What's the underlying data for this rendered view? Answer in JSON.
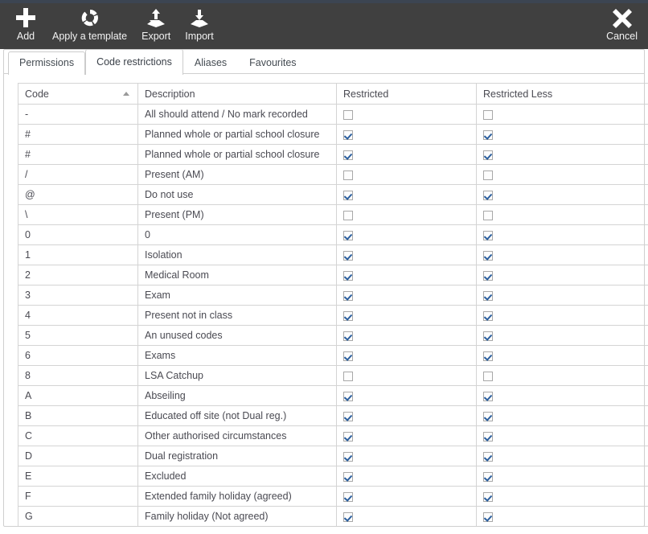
{
  "toolbar": {
    "buttons": [
      {
        "label": "Add",
        "icon": "plus-icon"
      },
      {
        "label": "Apply a template",
        "icon": "template-refresh-icon"
      },
      {
        "label": "Export",
        "icon": "export-up-arrow-icon"
      },
      {
        "label": "Import",
        "icon": "import-down-arrow-icon"
      }
    ],
    "cancel": {
      "label": "Cancel",
      "icon": "close-x-icon"
    },
    "background_color": "#404040",
    "accent_strip_color": "#3c4552"
  },
  "tabs": [
    {
      "label": "Permissions",
      "active": false
    },
    {
      "label": "Code restrictions",
      "active": true
    },
    {
      "label": "Aliases",
      "active": false
    },
    {
      "label": "Favourites",
      "active": false
    }
  ],
  "grid": {
    "columns": [
      {
        "key": "code",
        "label": "Code",
        "sort": "asc"
      },
      {
        "key": "description",
        "label": "Description",
        "sort": ""
      },
      {
        "key": "restricted",
        "label": "Restricted",
        "sort": ""
      },
      {
        "key": "restricted_less",
        "label": "Restricted Less",
        "sort": ""
      }
    ],
    "rows": [
      {
        "code": "-",
        "description": "All should attend / No mark recorded",
        "restricted": false,
        "restricted_less": false
      },
      {
        "code": "#",
        "description": "Planned whole or partial school closure",
        "restricted": true,
        "restricted_less": true
      },
      {
        "code": "#",
        "description": "Planned whole or partial school closure",
        "restricted": true,
        "restricted_less": true
      },
      {
        "code": "/",
        "description": "Present (AM)",
        "restricted": false,
        "restricted_less": false
      },
      {
        "code": "@",
        "description": "Do not use",
        "restricted": true,
        "restricted_less": true
      },
      {
        "code": "\\",
        "description": "Present (PM)",
        "restricted": false,
        "restricted_less": false
      },
      {
        "code": "0",
        "description": "0",
        "restricted": true,
        "restricted_less": true
      },
      {
        "code": "1",
        "description": "Isolation",
        "restricted": true,
        "restricted_less": true
      },
      {
        "code": "2",
        "description": "Medical Room",
        "restricted": true,
        "restricted_less": true
      },
      {
        "code": "3",
        "description": "Exam",
        "restricted": true,
        "restricted_less": true
      },
      {
        "code": "4",
        "description": "Present not in class",
        "restricted": true,
        "restricted_less": true
      },
      {
        "code": "5",
        "description": "An unused codes",
        "restricted": true,
        "restricted_less": true
      },
      {
        "code": "6",
        "description": "Exams",
        "restricted": true,
        "restricted_less": true
      },
      {
        "code": "8",
        "description": "LSA Catchup",
        "restricted": false,
        "restricted_less": false
      },
      {
        "code": "A",
        "description": "Abseiling",
        "restricted": true,
        "restricted_less": true
      },
      {
        "code": "B",
        "description": "Educated off site (not Dual reg.)",
        "restricted": true,
        "restricted_less": true
      },
      {
        "code": "C",
        "description": "Other authorised circumstances",
        "restricted": true,
        "restricted_less": true
      },
      {
        "code": "D",
        "description": "Dual registration",
        "restricted": true,
        "restricted_less": true
      },
      {
        "code": "E",
        "description": "Excluded",
        "restricted": true,
        "restricted_less": true
      },
      {
        "code": "F",
        "description": "Extended family holiday (agreed)",
        "restricted": true,
        "restricted_less": true
      },
      {
        "code": "G",
        "description": "Family holiday (Not agreed)",
        "restricted": true,
        "restricted_less": true
      }
    ]
  },
  "colors": {
    "checkbox_tick": "#2c5f9e",
    "checkbox_border": "#a8a8a8",
    "grid_border": "#d4d4d4",
    "text": "#4a4a52"
  }
}
